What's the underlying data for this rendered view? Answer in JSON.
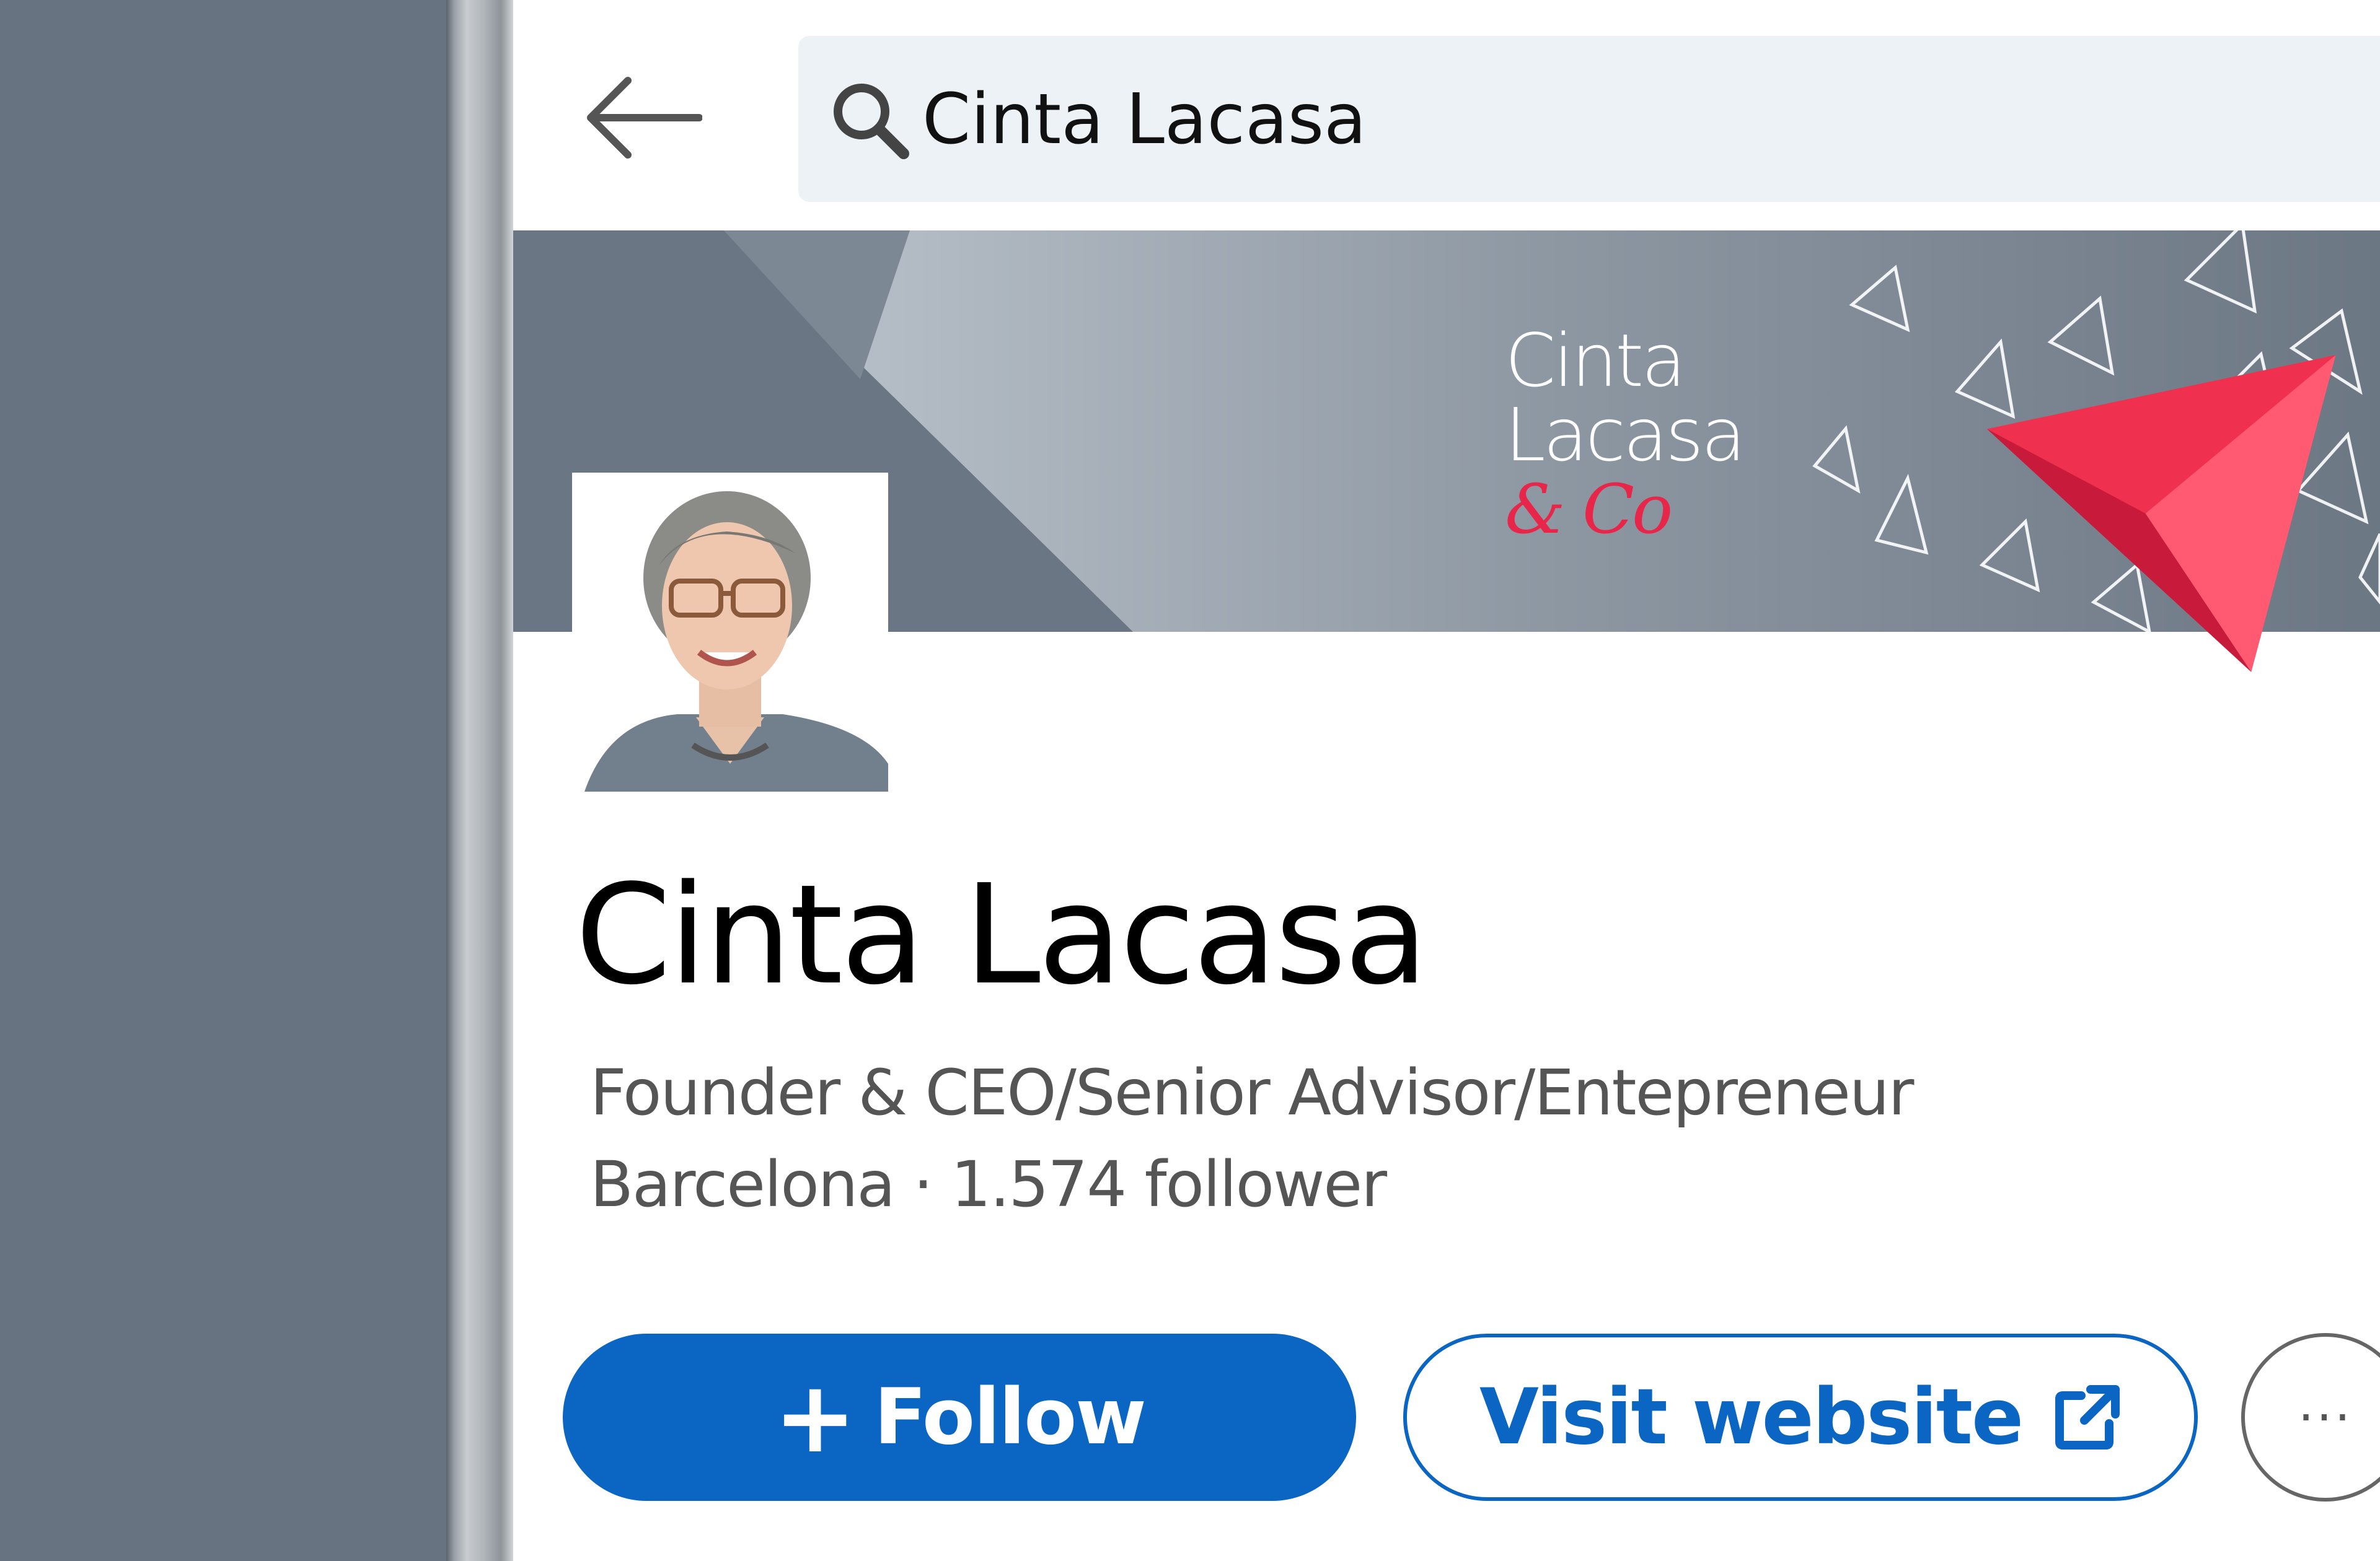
{
  "search": {
    "query": "Cinta Lacasa"
  },
  "banner": {
    "brand_line1": "Cinta",
    "brand_line2": "Lacasa",
    "brand_line3": "& Co",
    "accent_color": "#e8264a"
  },
  "profile": {
    "name": "Cinta Lacasa",
    "headline": "Founder & CEO/Senior Advisor/Entepreneur",
    "meta": "Barcelona · 1.574 follower"
  },
  "actions": {
    "follow_icon": "+",
    "follow_label": "Follow",
    "visit_label": "Visit website",
    "more_label": "···",
    "primary_color": "#0a66c2"
  },
  "icons": {
    "back": "back-arrow-icon",
    "search": "search-icon",
    "external": "external-link-icon",
    "more": "more-icon"
  }
}
